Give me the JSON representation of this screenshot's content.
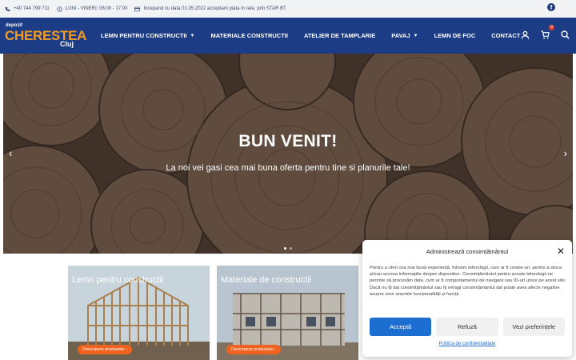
{
  "topbar": {
    "phone": "+40 744 799 711",
    "hours": "LUNI - VINERI: 08:00 - 17:00",
    "payment_note": "Incepand cu data 01.05.2022 acceptam plata in rate, prin STAR BT"
  },
  "logo": {
    "small": "depozit",
    "big": "CHERESTEA",
    "city": "Cluj"
  },
  "nav": {
    "items": [
      {
        "label": "LEMN PENTRU CONSTRUCTII",
        "dropdown": true
      },
      {
        "label": "MATERIALE CONSTRUCTII",
        "dropdown": false
      },
      {
        "label": "ATELIER DE TAMPLARIE",
        "dropdown": false
      },
      {
        "label": "PAVAJ",
        "dropdown": true
      },
      {
        "label": "LEMN DE FOC",
        "dropdown": false
      },
      {
        "label": "CONTACT",
        "dropdown": false
      }
    ],
    "cart_count": "0"
  },
  "hero": {
    "title": "BUN VENIT!",
    "subtitle": "La noi vei gasi cea mai buna oferta pentru tine si planurile tale!",
    "prev_arrow": "‹",
    "next_arrow": "›"
  },
  "cards": [
    {
      "label": "Lemn pentru constructii",
      "button": "Descopera produsele ›"
    },
    {
      "label": "Materiale de constructii",
      "button": "Descopera produsele ›"
    }
  ],
  "consent": {
    "title": "Administrează consimțământul",
    "text": "Pentru a oferi cea mai bună experiență, folosim tehnologii, cum ar fi cookie-uri, pentru a stoca și/sau accesa informațiile despre dispozitive. Consimțământul pentru aceste tehnologii ne permite să procesăm date, cum ar fi comportamentul de navigare sau ID-uri unice pe acest site. Dacă nu îți dai consimțământul sau îți retragi consimțământul dat poate avea afecte negative asupra unor anumite funcționalități și funcții.",
    "accept": "Acceptă",
    "refuse": "Refuză",
    "preferences": "Vezi preferințele",
    "policy": "Politica de confidentialitate"
  },
  "colors": {
    "header_bg": "#1c3c85",
    "logo_orange": "#f39a21",
    "accept_blue": "#1c6fd1",
    "card_button": "#f0621f"
  }
}
